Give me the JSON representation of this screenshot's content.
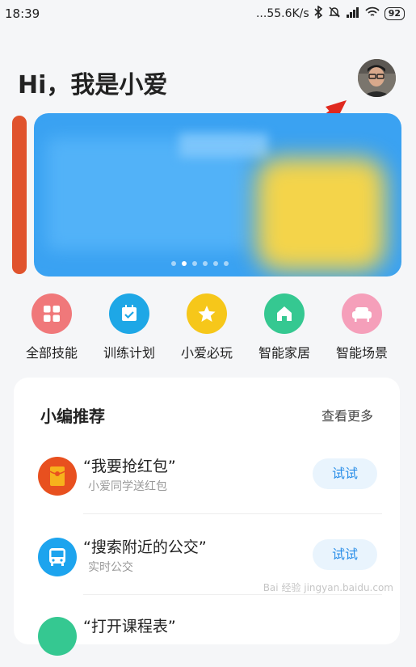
{
  "status": {
    "time": "18:39",
    "network": "...55.6K/s",
    "battery": "92"
  },
  "greeting": "Hi，我是小爱",
  "quick": [
    {
      "label": "全部技能",
      "icon": "grid-icon",
      "color": "#f0787a"
    },
    {
      "label": "训练计划",
      "icon": "calendar-check-icon",
      "color": "#1ea7e6"
    },
    {
      "label": "小爱必玩",
      "icon": "star-icon",
      "color": "#f6c71a"
    },
    {
      "label": "智能家居",
      "icon": "home-icon",
      "color": "#35c891"
    },
    {
      "label": "智能场景",
      "icon": "sofa-icon",
      "color": "#f59fba"
    }
  ],
  "recommend": {
    "title": "小编推荐",
    "more": "查看更多",
    "items": [
      {
        "title": "“我要抢红包”",
        "subtitle": "小爱同学送红包",
        "button": "试试",
        "icon": "red-packet-icon",
        "color": "#e8501f"
      },
      {
        "title": "“搜索附近的公交”",
        "subtitle": "实时公交",
        "button": "试试",
        "icon": "bus-icon",
        "color": "#1da4ee"
      },
      {
        "title": "“打开课程表”",
        "subtitle": "",
        "button": "",
        "icon": "schedule-icon",
        "color": "#35c891"
      }
    ]
  },
  "watermark": "Bai 经验 jingyan.baidu.com"
}
